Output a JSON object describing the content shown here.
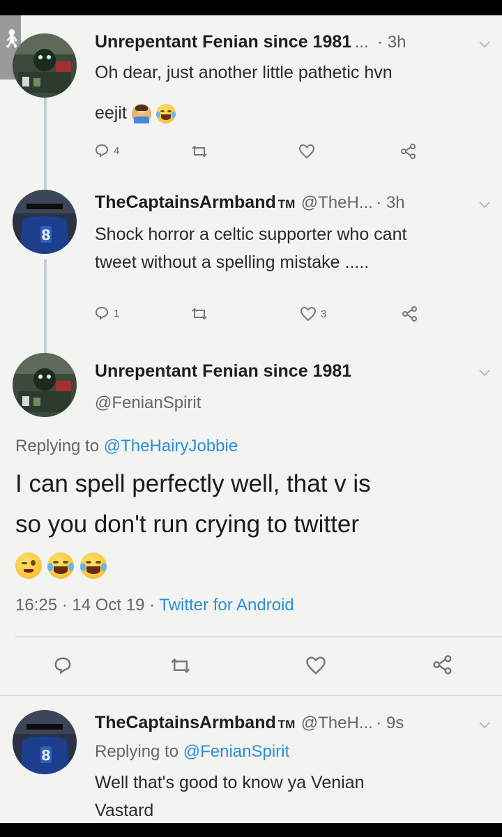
{
  "tweet1": {
    "name": "Unrepentant Fenian since 1981",
    "ellipsis": "...",
    "time": "· 3h",
    "text": "Oh dear, just another little pathetic hvn",
    "text2": "eejit",
    "reply_count": "4",
    "like_count": ""
  },
  "tweet2": {
    "name": "TheCaptainsArmband",
    "tm": "TM",
    "handle": "@TheH...",
    "time": "· 3h",
    "text": "Shock horror a celtic supporter  who cant",
    "text2": "tweet without a spelling mistake .....",
    "reply_count": "1",
    "like_count": "3"
  },
  "main_tweet": {
    "name": "Unrepentant Fenian since 1981",
    "handle": "@FenianSpirit",
    "replying_prefix": "Replying to ",
    "replying_to": "@TheHairyJobbie",
    "text_line1": "I can spell perfectly well, that v is",
    "text_line2": "so you don't run crying to twitter",
    "timestamp": "16:25 · 14 Oct 19 · ",
    "client": "Twitter for Android"
  },
  "tweet4": {
    "name": "TheCaptainsArmband",
    "tm": "TM",
    "handle": "@TheH...",
    "time": "· 9s",
    "replying_prefix": "Replying to ",
    "replying_to": "@FenianSpirit",
    "text_line1": "Well that's good to know ya Venian",
    "text_line2": "Vastard"
  },
  "icons": {
    "accessibility": "accessibility-icon",
    "reply": "reply-icon",
    "retweet": "retweet-icon",
    "like": "heart-icon",
    "share": "share-icon",
    "menu": "chevron-down-icon"
  },
  "colors": {
    "link": "#2a8fd6",
    "background": "#f3f3f1",
    "text": "#222222",
    "secondary": "#666666"
  }
}
